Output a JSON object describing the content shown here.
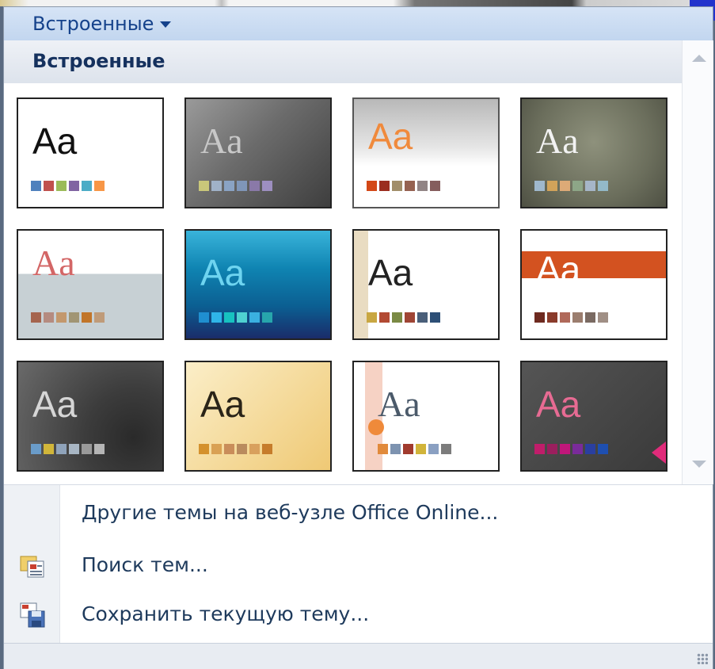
{
  "header": {
    "label": "Встроенные"
  },
  "section": {
    "label": "Встроенные"
  },
  "themes": [
    {
      "label": "Aa",
      "name": "theme-office"
    },
    {
      "label": "Aa",
      "name": "theme-2"
    },
    {
      "label": "Aa",
      "name": "theme-3"
    },
    {
      "label": "Aa",
      "name": "theme-4"
    },
    {
      "label": "Aa",
      "name": "theme-5"
    },
    {
      "label": "Aa",
      "name": "theme-6"
    },
    {
      "label": "Aa",
      "name": "theme-7"
    },
    {
      "label": "Aa",
      "name": "theme-8"
    },
    {
      "label": "Aa",
      "name": "theme-9"
    },
    {
      "label": "Aa",
      "name": "theme-10"
    },
    {
      "label": "Aa",
      "name": "theme-11"
    },
    {
      "label": "Aa",
      "name": "theme-12"
    }
  ],
  "menu": {
    "more_themes": "Другие темы на веб-узле Office Online...",
    "browse_themes": "Поиск тем...",
    "save_theme": "Сохранить текущую тему..."
  },
  "colors": {
    "header_text": "#15428b",
    "menu_text": "#1e3a5c",
    "accent_blue": "#2233cc"
  }
}
